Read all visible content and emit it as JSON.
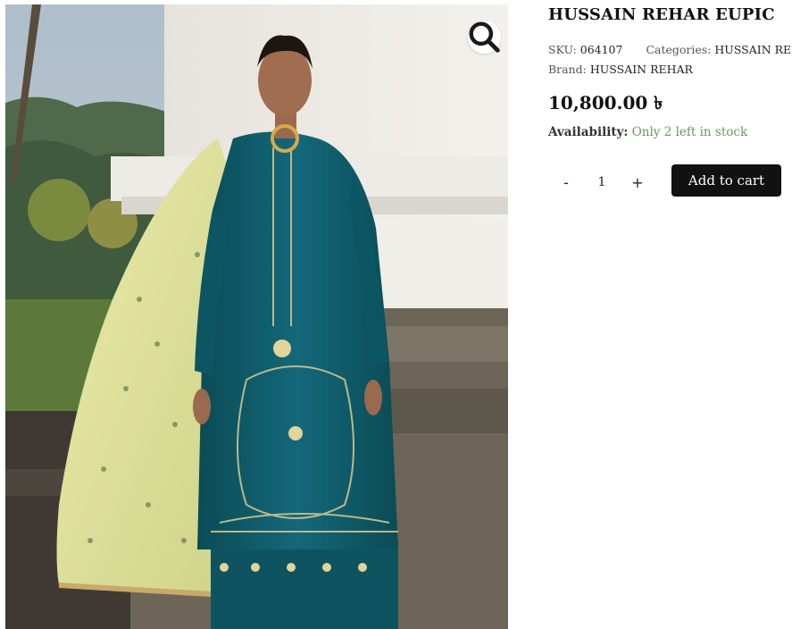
{
  "product": {
    "title": "HUSSAIN REHAR EUPIC",
    "sku_label": "SKU:",
    "sku": "064107",
    "categories_label": "Categories:",
    "categories": "HUSSAIN REHAR D...",
    "brand_label": "Brand:",
    "brand": "HUSSAIN REHAR",
    "price": "10,800.00 ৳",
    "availability_label": "Availability:",
    "availability": "Only 2 left in stock"
  },
  "cart": {
    "minus_label": "-",
    "quantity": "1",
    "plus_label": "+",
    "add_label": "Add to cart"
  },
  "gallery": {
    "zoom_icon": "search-icon",
    "image_description": "model-in-teal-embroidered-suit"
  },
  "colors": {
    "button_bg": "#111111",
    "stock_green": "#6a9a5a",
    "dress_teal": "#0f5a66",
    "dupatta_yellow": "#dfe29a"
  }
}
